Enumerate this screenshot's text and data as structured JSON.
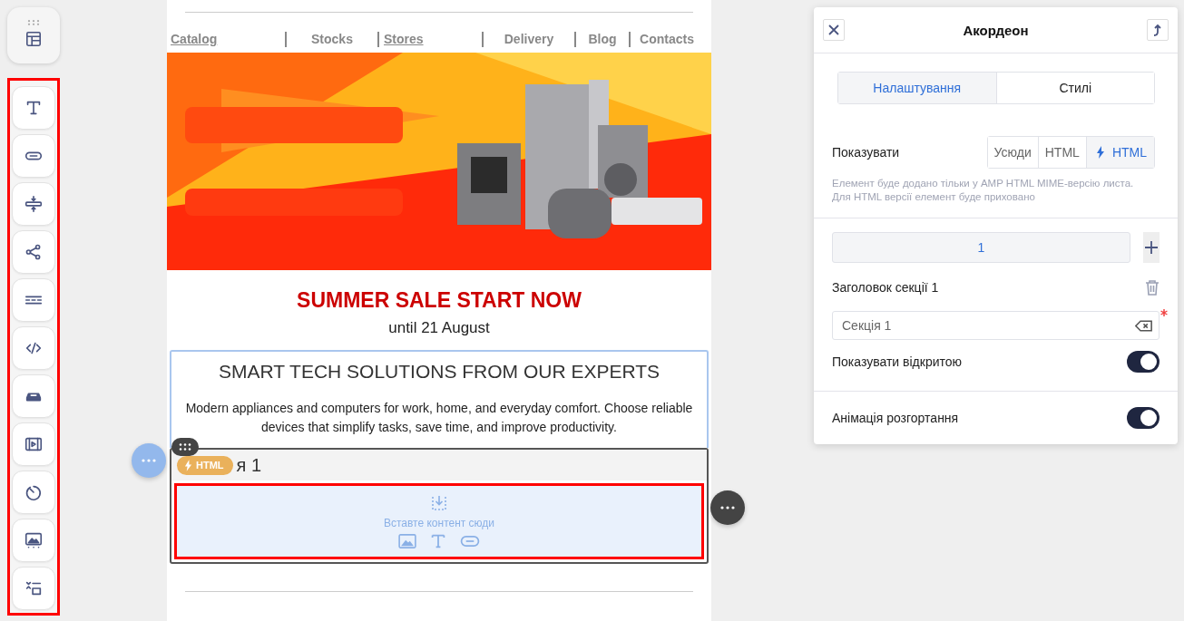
{
  "email": {
    "nav": [
      {
        "label": "Catalog",
        "underlined": true
      },
      {
        "label": "Stocks",
        "underlined": false
      },
      {
        "label": "Stores",
        "underlined": true
      },
      {
        "label": "Delivery",
        "underlined": false
      },
      {
        "label": "Blog",
        "underlined": false
      },
      {
        "label": "Contacts",
        "underlined": false
      }
    ],
    "headline": "SUMMER SALE START NOW",
    "subheadline": "until 21 August",
    "block": {
      "title": "SMART TECH SOLUTIONS FROM OUR EXPERTS",
      "text": "Modern appliances and computers for work, home, and everyday comfort. Choose reliable devices that simplify tasks, save time, and improve productivity."
    },
    "accordion": {
      "badge": "HTML",
      "title": "я 1",
      "dropzone_hint": "Вставте контент сюди"
    }
  },
  "panel": {
    "title": "Акордеон",
    "tabs": [
      {
        "label": "Налаштування",
        "selected": true
      },
      {
        "label": "Стилі",
        "selected": false
      }
    ],
    "show": {
      "label": "Показувати",
      "options": [
        {
          "label": "Усюди",
          "kind": "plain",
          "selected": false
        },
        {
          "label": "HTML",
          "kind": "plain",
          "selected": false
        },
        {
          "label": "HTML",
          "kind": "amp",
          "selected": true
        }
      ],
      "hint": "Елемент буде додано тільки у AMP HTML MIME-версію листа. Для HTML версії елемент буде приховано"
    },
    "sections": [
      {
        "label": "1",
        "selected": true
      }
    ],
    "section_title_label": "Заголовок секції 1",
    "section_title_value": "Секція 1",
    "toggles": [
      {
        "label": "Показувати відкритою",
        "on": true
      },
      {
        "label": "Анімація розгортання",
        "on": true
      }
    ]
  }
}
